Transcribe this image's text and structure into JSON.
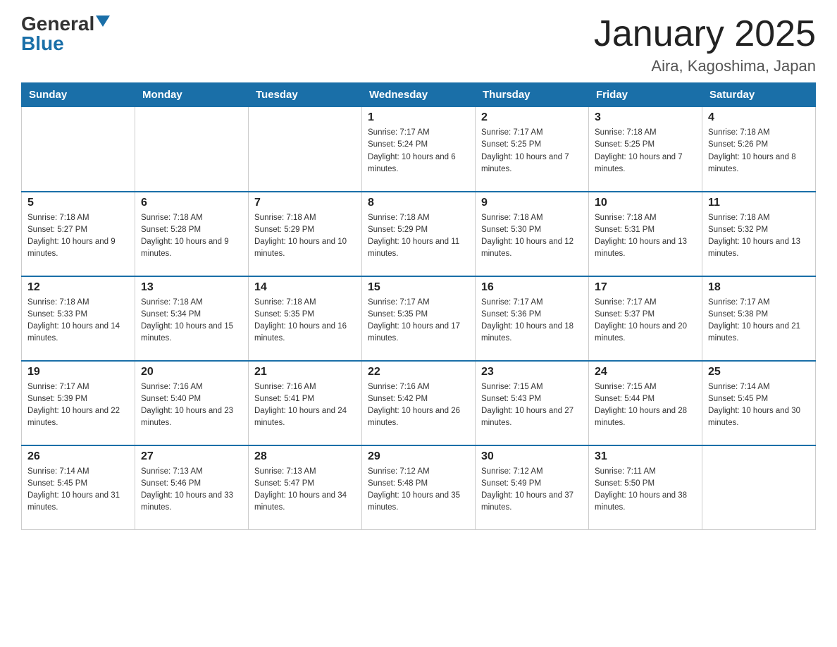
{
  "header": {
    "logo_general": "General",
    "logo_blue": "Blue",
    "title": "January 2025",
    "location": "Aira, Kagoshima, Japan"
  },
  "calendar": {
    "days_of_week": [
      "Sunday",
      "Monday",
      "Tuesday",
      "Wednesday",
      "Thursday",
      "Friday",
      "Saturday"
    ],
    "weeks": [
      [
        {
          "day": "",
          "info": ""
        },
        {
          "day": "",
          "info": ""
        },
        {
          "day": "",
          "info": ""
        },
        {
          "day": "1",
          "info": "Sunrise: 7:17 AM\nSunset: 5:24 PM\nDaylight: 10 hours and 6 minutes."
        },
        {
          "day": "2",
          "info": "Sunrise: 7:17 AM\nSunset: 5:25 PM\nDaylight: 10 hours and 7 minutes."
        },
        {
          "day": "3",
          "info": "Sunrise: 7:18 AM\nSunset: 5:25 PM\nDaylight: 10 hours and 7 minutes."
        },
        {
          "day": "4",
          "info": "Sunrise: 7:18 AM\nSunset: 5:26 PM\nDaylight: 10 hours and 8 minutes."
        }
      ],
      [
        {
          "day": "5",
          "info": "Sunrise: 7:18 AM\nSunset: 5:27 PM\nDaylight: 10 hours and 9 minutes."
        },
        {
          "day": "6",
          "info": "Sunrise: 7:18 AM\nSunset: 5:28 PM\nDaylight: 10 hours and 9 minutes."
        },
        {
          "day": "7",
          "info": "Sunrise: 7:18 AM\nSunset: 5:29 PM\nDaylight: 10 hours and 10 minutes."
        },
        {
          "day": "8",
          "info": "Sunrise: 7:18 AM\nSunset: 5:29 PM\nDaylight: 10 hours and 11 minutes."
        },
        {
          "day": "9",
          "info": "Sunrise: 7:18 AM\nSunset: 5:30 PM\nDaylight: 10 hours and 12 minutes."
        },
        {
          "day": "10",
          "info": "Sunrise: 7:18 AM\nSunset: 5:31 PM\nDaylight: 10 hours and 13 minutes."
        },
        {
          "day": "11",
          "info": "Sunrise: 7:18 AM\nSunset: 5:32 PM\nDaylight: 10 hours and 13 minutes."
        }
      ],
      [
        {
          "day": "12",
          "info": "Sunrise: 7:18 AM\nSunset: 5:33 PM\nDaylight: 10 hours and 14 minutes."
        },
        {
          "day": "13",
          "info": "Sunrise: 7:18 AM\nSunset: 5:34 PM\nDaylight: 10 hours and 15 minutes."
        },
        {
          "day": "14",
          "info": "Sunrise: 7:18 AM\nSunset: 5:35 PM\nDaylight: 10 hours and 16 minutes."
        },
        {
          "day": "15",
          "info": "Sunrise: 7:17 AM\nSunset: 5:35 PM\nDaylight: 10 hours and 17 minutes."
        },
        {
          "day": "16",
          "info": "Sunrise: 7:17 AM\nSunset: 5:36 PM\nDaylight: 10 hours and 18 minutes."
        },
        {
          "day": "17",
          "info": "Sunrise: 7:17 AM\nSunset: 5:37 PM\nDaylight: 10 hours and 20 minutes."
        },
        {
          "day": "18",
          "info": "Sunrise: 7:17 AM\nSunset: 5:38 PM\nDaylight: 10 hours and 21 minutes."
        }
      ],
      [
        {
          "day": "19",
          "info": "Sunrise: 7:17 AM\nSunset: 5:39 PM\nDaylight: 10 hours and 22 minutes."
        },
        {
          "day": "20",
          "info": "Sunrise: 7:16 AM\nSunset: 5:40 PM\nDaylight: 10 hours and 23 minutes."
        },
        {
          "day": "21",
          "info": "Sunrise: 7:16 AM\nSunset: 5:41 PM\nDaylight: 10 hours and 24 minutes."
        },
        {
          "day": "22",
          "info": "Sunrise: 7:16 AM\nSunset: 5:42 PM\nDaylight: 10 hours and 26 minutes."
        },
        {
          "day": "23",
          "info": "Sunrise: 7:15 AM\nSunset: 5:43 PM\nDaylight: 10 hours and 27 minutes."
        },
        {
          "day": "24",
          "info": "Sunrise: 7:15 AM\nSunset: 5:44 PM\nDaylight: 10 hours and 28 minutes."
        },
        {
          "day": "25",
          "info": "Sunrise: 7:14 AM\nSunset: 5:45 PM\nDaylight: 10 hours and 30 minutes."
        }
      ],
      [
        {
          "day": "26",
          "info": "Sunrise: 7:14 AM\nSunset: 5:45 PM\nDaylight: 10 hours and 31 minutes."
        },
        {
          "day": "27",
          "info": "Sunrise: 7:13 AM\nSunset: 5:46 PM\nDaylight: 10 hours and 33 minutes."
        },
        {
          "day": "28",
          "info": "Sunrise: 7:13 AM\nSunset: 5:47 PM\nDaylight: 10 hours and 34 minutes."
        },
        {
          "day": "29",
          "info": "Sunrise: 7:12 AM\nSunset: 5:48 PM\nDaylight: 10 hours and 35 minutes."
        },
        {
          "day": "30",
          "info": "Sunrise: 7:12 AM\nSunset: 5:49 PM\nDaylight: 10 hours and 37 minutes."
        },
        {
          "day": "31",
          "info": "Sunrise: 7:11 AM\nSunset: 5:50 PM\nDaylight: 10 hours and 38 minutes."
        },
        {
          "day": "",
          "info": ""
        }
      ]
    ]
  }
}
